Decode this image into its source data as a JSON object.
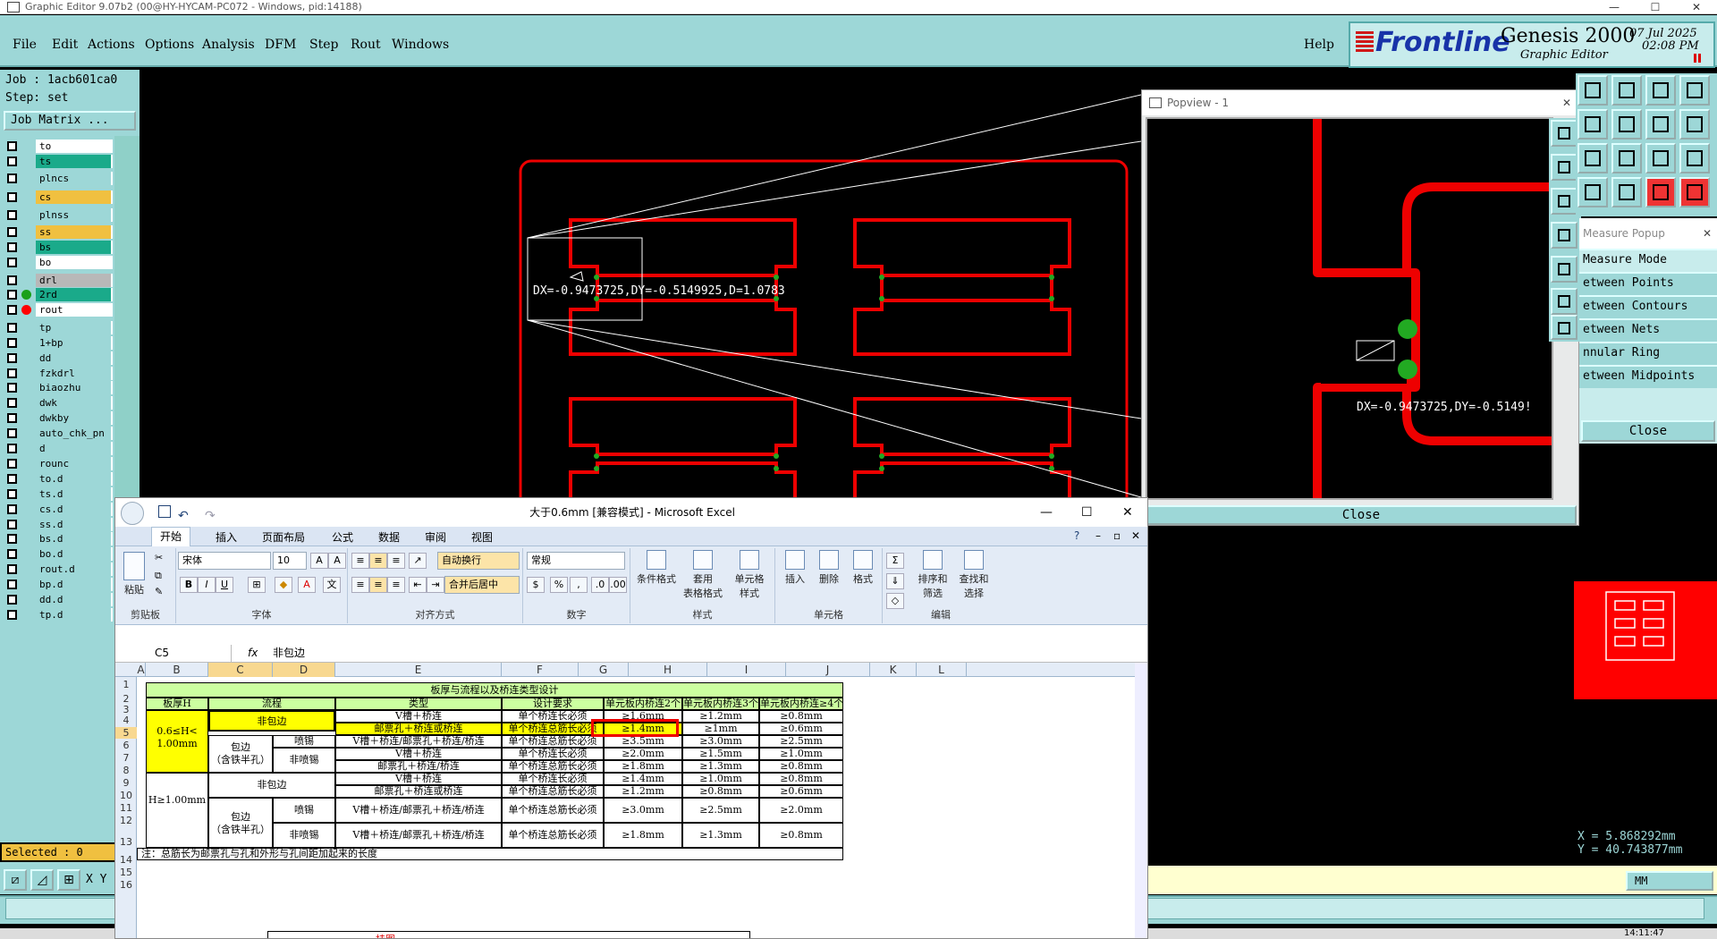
{
  "window": {
    "title": "Graphic Editor 9.07b2 (00@HY-HYCAM-PC072 - Windows, pid:14188)"
  },
  "menu": [
    "File",
    "Edit",
    "Actions",
    "Options",
    "Analysis",
    "DFM",
    "Step",
    "Rout",
    "Windows"
  ],
  "help": "Help",
  "brand": {
    "logo": "Frontline",
    "product": "Genesis 2000",
    "sub": "Graphic Editor",
    "date": "07 Jul 2025",
    "time": "02:08 PM"
  },
  "job": {
    "job_line": "Job : 1acb601ca0",
    "step_line": "Step: set",
    "matrix_btn": "Job Matrix ..."
  },
  "layers": [
    {
      "name": "to",
      "bg": "#ffffff"
    },
    {
      "name": "ts",
      "bg": "#1aaa8a"
    },
    {
      "name": "plncs",
      "bg": "#9dd7d7"
    },
    {
      "name": "cs",
      "bg": "#f0c040"
    },
    {
      "name": "plnss",
      "bg": "#9dd7d7"
    },
    {
      "name": "ss",
      "bg": "#f0c040"
    },
    {
      "name": "bs",
      "bg": "#1aaa8a"
    },
    {
      "name": "bo",
      "bg": "#ffffff"
    },
    {
      "name": "drl",
      "bg": "#b8b8b8"
    },
    {
      "name": "2rd",
      "bg": "#1aaa8a",
      "dot": "#1aa01a"
    },
    {
      "name": "rout",
      "bg": "#ffffff",
      "dot": "#ff0000"
    },
    {
      "name": "tp",
      "bg": "#9dd7d7"
    },
    {
      "name": "1+bp",
      "bg": "#9dd7d7"
    },
    {
      "name": "dd",
      "bg": "#9dd7d7"
    },
    {
      "name": "fzkdrl",
      "bg": "#9dd7d7"
    },
    {
      "name": "biaozhu",
      "bg": "#9dd7d7"
    },
    {
      "name": "dwk",
      "bg": "#9dd7d7"
    },
    {
      "name": "dwkby",
      "bg": "#9dd7d7"
    },
    {
      "name": "auto_chk_pn",
      "bg": "#9dd7d7"
    },
    {
      "name": "d",
      "bg": "#9dd7d7"
    },
    {
      "name": "rounc",
      "bg": "#9dd7d7"
    },
    {
      "name": "to.d",
      "bg": "#9dd7d7"
    },
    {
      "name": "ts.d",
      "bg": "#9dd7d7"
    },
    {
      "name": "cs.d",
      "bg": "#9dd7d7"
    },
    {
      "name": "ss.d",
      "bg": "#9dd7d7"
    },
    {
      "name": "bs.d",
      "bg": "#9dd7d7"
    },
    {
      "name": "bo.d",
      "bg": "#9dd7d7"
    },
    {
      "name": "rout.d",
      "bg": "#9dd7d7"
    },
    {
      "name": "bp.d",
      "bg": "#9dd7d7"
    },
    {
      "name": "dd.d",
      "bg": "#9dd7d7"
    },
    {
      "name": "tp.d",
      "bg": "#9dd7d7"
    }
  ],
  "selected": "Selected : 0",
  "xy_label": "X Y",
  "canvas": {
    "measure_text": "DX=-0.9473725,DY=-0.5149925,D=1.0783"
  },
  "popview": {
    "title": "Popview - 1",
    "measure_text": "DX=-0.9473725,DY=-0.5149!",
    "close": "Close"
  },
  "measure_popup": {
    "title": "Measure Popup",
    "items": [
      "Measure Mode",
      "etween Points",
      "etween Contours",
      "etween Nets",
      "nnular Ring",
      "etween Midpoints"
    ],
    "close": "Close"
  },
  "coords": {
    "x": "X = 5.868292mm",
    "y": "Y = 40.743877mm"
  },
  "units": "MM",
  "clock": "14:11:47",
  "excel": {
    "title": "大于0.6mm  [兼容模式] - Microsoft Excel",
    "tabs": [
      "开始",
      "插入",
      "页面布局",
      "公式",
      "数据",
      "审阅",
      "视图"
    ],
    "font_name": "宋体",
    "font_size": "10",
    "number_format": "常规",
    "wrap": "自动换行",
    "merge": "合并后居中",
    "groups": [
      "剪贴板",
      "字体",
      "对齐方式",
      "数字",
      "样式",
      "单元格",
      "编辑"
    ],
    "paste": "粘贴",
    "cond_fmt": "条件格式",
    "table_fmt": "套用\n表格格式",
    "cell_style": "单元格\n样式",
    "insert": "插入",
    "delete": "删除",
    "format": "格式",
    "sort": "排序和\n筛选",
    "find": "查找和\n选择",
    "cell_ref": "C5",
    "fx": "fx",
    "formula": "非包边",
    "cols": [
      "A",
      "B",
      "C",
      "D",
      "E",
      "F",
      "G",
      "H",
      "I",
      "J",
      "K",
      "L"
    ],
    "rows": [
      "1",
      "2",
      "3",
      "4",
      "5",
      "6",
      "7",
      "8",
      "9",
      "10",
      "11",
      "12",
      "13",
      "14",
      "15",
      "16"
    ],
    "table": {
      "title": "板厚与流程以及桥连类型设计",
      "headers": [
        "板厚H",
        "流程",
        "类型",
        "设计要求",
        "单元板内桥连2个",
        "单元板内桥连3个",
        "单元板内桥连≥4个"
      ],
      "thickA": "0.6≤H<\n1.00mm",
      "thickB": "H≥1.00mm",
      "nonwrap": "非包边",
      "wrap": "包边\n（含铁半孔）",
      "spray": "喷锡",
      "nospray": "非喷锡",
      "rows": [
        [
          "V槽＋桥连",
          "单个桥连长必须",
          "≥1.6mm",
          "≥1.2mm",
          "≥0.8mm"
        ],
        [
          "邮票孔＋桥连或桥连",
          "单个桥连总筋长必须",
          "≥1.4mm",
          "≥1mm",
          "≥0.6mm"
        ],
        [
          "V槽＋桥连/邮票孔＋桥连/桥连",
          "单个桥连总筋长必须",
          "≥3.5mm",
          "≥3.0mm",
          "≥2.5mm"
        ],
        [
          "V槽＋桥连",
          "单个桥连长必须",
          "≥2.0mm",
          "≥1.5mm",
          "≥1.0mm"
        ],
        [
          "邮票孔＋桥连/桥连",
          "单个桥连总筋长必须",
          "≥1.8mm",
          "≥1.3mm",
          "≥0.8mm"
        ],
        [
          "V槽＋桥连",
          "单个桥连长必须",
          "≥1.4mm",
          "≥1.0mm",
          "≥0.8mm"
        ],
        [
          "邮票孔＋桥连或桥连",
          "单个桥连总筋长必须",
          "≥1.2mm",
          "≥0.8mm",
          "≥0.6mm"
        ],
        [
          "V槽＋桥连/邮票孔＋桥连/桥连",
          "单个桥连总筋长必须",
          "≥3.0mm",
          "≥2.5mm",
          "≥2.0mm"
        ],
        [
          "V槽＋桥连/邮票孔＋桥连/桥连",
          "单个桥连总筋长必须",
          "≥1.8mm",
          "≥1.3mm",
          "≥0.8mm"
        ]
      ],
      "note": "注：总筋长为邮票孔与孔和外形与孔间距加起来的长度",
      "row16": "挂图"
    }
  }
}
